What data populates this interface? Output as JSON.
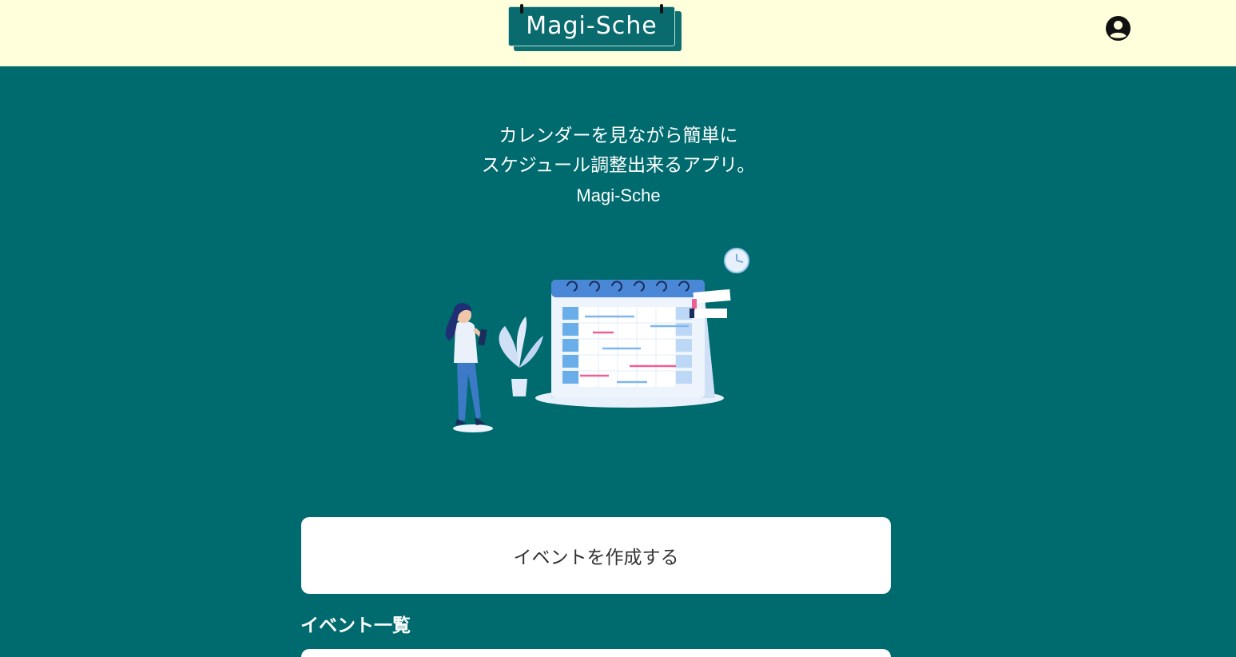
{
  "header": {
    "logo_text": "Magi-Sche",
    "account_icon": "account-circle-icon"
  },
  "hero": {
    "line1": "カレンダーを見ながら簡単に",
    "line2": "スケジュール調整出来るアプリ。",
    "brand": "Magi-Sche",
    "illustration_icon": "calendar-planning-illustration"
  },
  "actions": {
    "create_event_label": "イベントを作成する"
  },
  "events": {
    "section_title": "イベント一覧"
  },
  "colors": {
    "header_bg": "#ffffdc",
    "page_bg": "#006b6e",
    "logo_bg": "#0a6b6e",
    "card_bg": "#ffffff"
  }
}
